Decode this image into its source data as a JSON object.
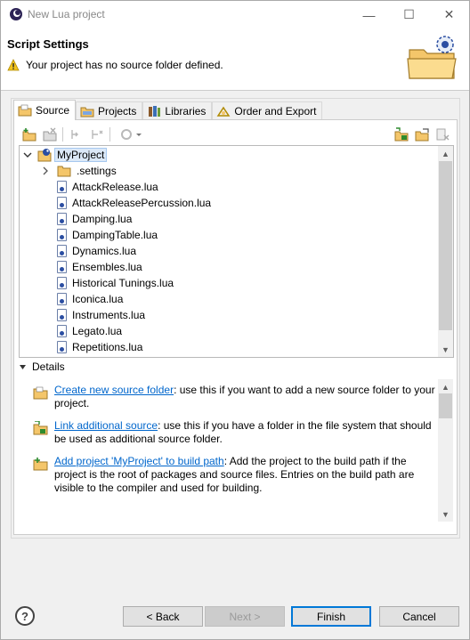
{
  "window": {
    "title": "New Lua project",
    "controls": {
      "minimize": "—",
      "maximize": "☐",
      "close": "✕"
    }
  },
  "header": {
    "title": "Script Settings",
    "message": "Your project has no source folder defined.",
    "icons": {
      "status": "warning-icon",
      "wizard": "folder-wizard-icon"
    }
  },
  "tabs": [
    {
      "label": "Source",
      "icon": "source-folder-icon",
      "active": true
    },
    {
      "label": "Projects",
      "icon": "projects-icon",
      "active": false
    },
    {
      "label": "Libraries",
      "icon": "libraries-icon",
      "active": false
    },
    {
      "label": "Order and Export",
      "icon": "order-export-icon",
      "active": false
    }
  ],
  "tree": {
    "root": "MyProject",
    "items": [
      {
        "label": ".settings",
        "type": "folder"
      },
      {
        "label": "AttackRelease.lua",
        "type": "file"
      },
      {
        "label": "AttackReleasePercussion.lua",
        "type": "file"
      },
      {
        "label": "Damping.lua",
        "type": "file"
      },
      {
        "label": "DampingTable.lua",
        "type": "file"
      },
      {
        "label": "Dynamics.lua",
        "type": "file"
      },
      {
        "label": "Ensembles.lua",
        "type": "file"
      },
      {
        "label": "Historical Tunings.lua",
        "type": "file"
      },
      {
        "label": "Iconica.lua",
        "type": "file"
      },
      {
        "label": "Instruments.lua",
        "type": "file"
      },
      {
        "label": "Legato.lua",
        "type": "file"
      },
      {
        "label": "Repetitions.lua",
        "type": "file"
      }
    ]
  },
  "details": {
    "heading": "Details",
    "items": [
      {
        "link": "Create new source folder",
        "text": ": use this if you want to add a new source folder to your project.",
        "icon": "new-source-folder-icon"
      },
      {
        "link": "Link additional source",
        "text": ": use this if you have a folder in the file system that should be used as additional source folder.",
        "icon": "link-source-icon"
      },
      {
        "link": "Add project 'MyProject' to build path",
        "text": ": Add the project to the build path if the project is the root of packages and source files. Entries on the build path are visible to the compiler and used for building.",
        "icon": "add-build-path-icon"
      }
    ]
  },
  "footer": {
    "help": "?",
    "back": "< Back",
    "next": "Next >",
    "finish": "Finish",
    "cancel": "Cancel"
  },
  "colors": {
    "link": "#0066cc",
    "accent": "#0078d7",
    "warning": "#f2c31b"
  }
}
